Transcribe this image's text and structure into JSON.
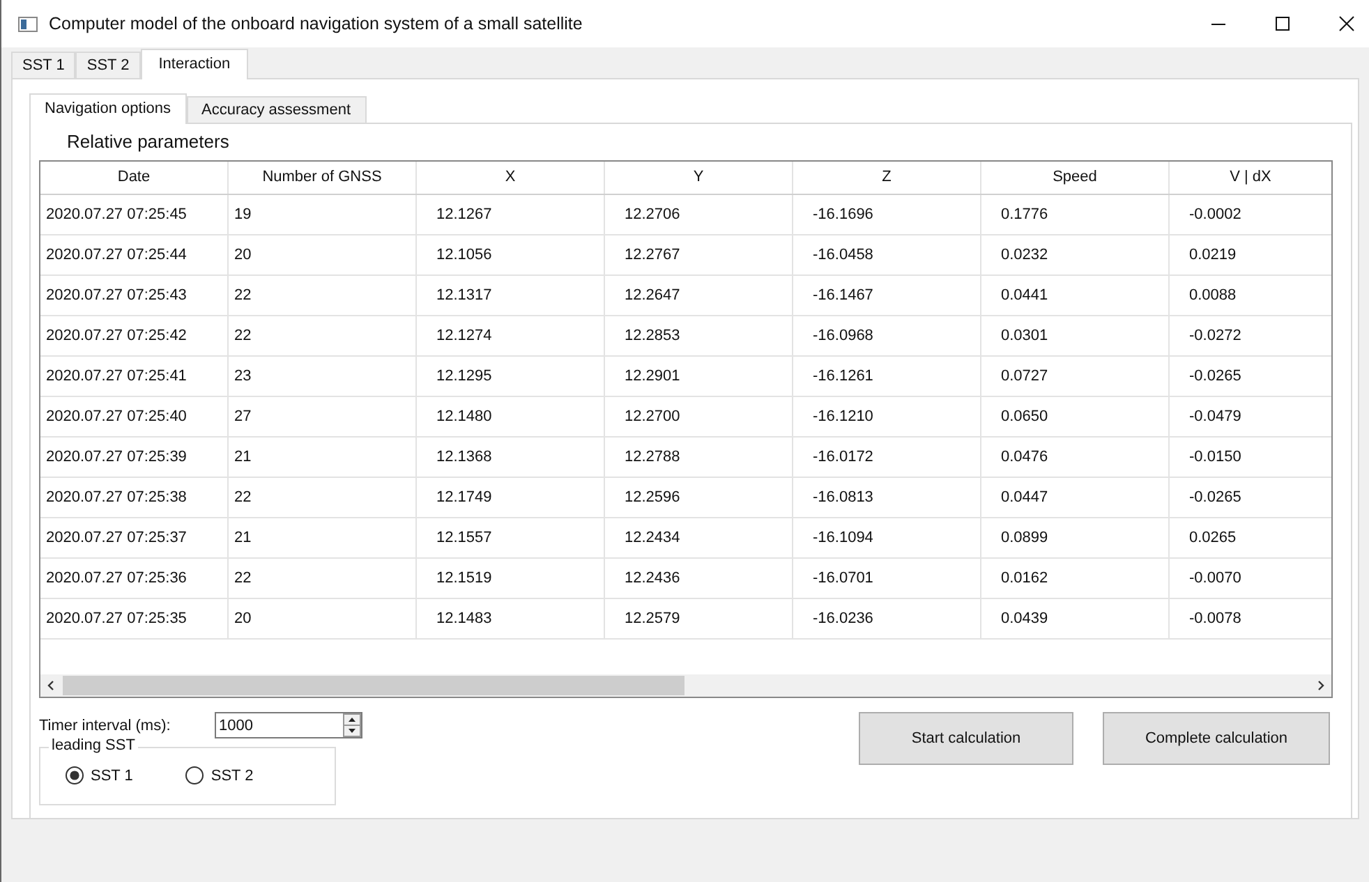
{
  "window": {
    "title": "Computer model of the onboard navigation system of a small satellite"
  },
  "tabs": [
    {
      "label": "SST 1",
      "selected": false
    },
    {
      "label": "SST 2",
      "selected": false
    },
    {
      "label": "Interaction",
      "selected": true
    }
  ],
  "subtabs": [
    {
      "label": "Navigation options",
      "selected": true
    },
    {
      "label": "Accuracy assessment",
      "selected": false
    }
  ],
  "section_title": "Relative parameters",
  "table": {
    "columns": [
      "Date",
      "Number of GNSS",
      "X",
      "Y",
      "Z",
      "Speed",
      "V | dX"
    ],
    "rows": [
      [
        "2020.07.27 07:25:45",
        "19",
        "12.1267",
        "12.2706",
        "-16.1696",
        "0.1776",
        "-0.0002"
      ],
      [
        "2020.07.27 07:25:44",
        "20",
        "12.1056",
        "12.2767",
        "-16.0458",
        "0.0232",
        "0.0219"
      ],
      [
        "2020.07.27 07:25:43",
        "22",
        "12.1317",
        "12.2647",
        "-16.1467",
        "0.0441",
        "0.0088"
      ],
      [
        "2020.07.27 07:25:42",
        "22",
        "12.1274",
        "12.2853",
        "-16.0968",
        "0.0301",
        "-0.0272"
      ],
      [
        "2020.07.27 07:25:41",
        "23",
        "12.1295",
        "12.2901",
        "-16.1261",
        "0.0727",
        "-0.0265"
      ],
      [
        "2020.07.27 07:25:40",
        "27",
        "12.1480",
        "12.2700",
        "-16.1210",
        "0.0650",
        "-0.0479"
      ],
      [
        "2020.07.27 07:25:39",
        "21",
        "12.1368",
        "12.2788",
        "-16.0172",
        "0.0476",
        "-0.0150"
      ],
      [
        "2020.07.27 07:25:38",
        "22",
        "12.1749",
        "12.2596",
        "-16.0813",
        "0.0447",
        "-0.0265"
      ],
      [
        "2020.07.27 07:25:37",
        "21",
        "12.1557",
        "12.2434",
        "-16.1094",
        "0.0899",
        "0.0265"
      ],
      [
        "2020.07.27 07:25:36",
        "22",
        "12.1519",
        "12.2436",
        "-16.0701",
        "0.0162",
        "-0.0070"
      ],
      [
        "2020.07.27 07:25:35",
        "20",
        "12.1483",
        "12.2579",
        "-16.0236",
        "0.0439",
        "-0.0078"
      ]
    ]
  },
  "timer": {
    "label": "Timer interval (ms):",
    "value": "1000"
  },
  "leading_sst": {
    "title": "leading SST",
    "options": [
      {
        "label": "SST 1",
        "selected": true
      },
      {
        "label": "SST 2",
        "selected": false
      }
    ]
  },
  "buttons": [
    "Start calculation",
    "Complete calculation"
  ]
}
